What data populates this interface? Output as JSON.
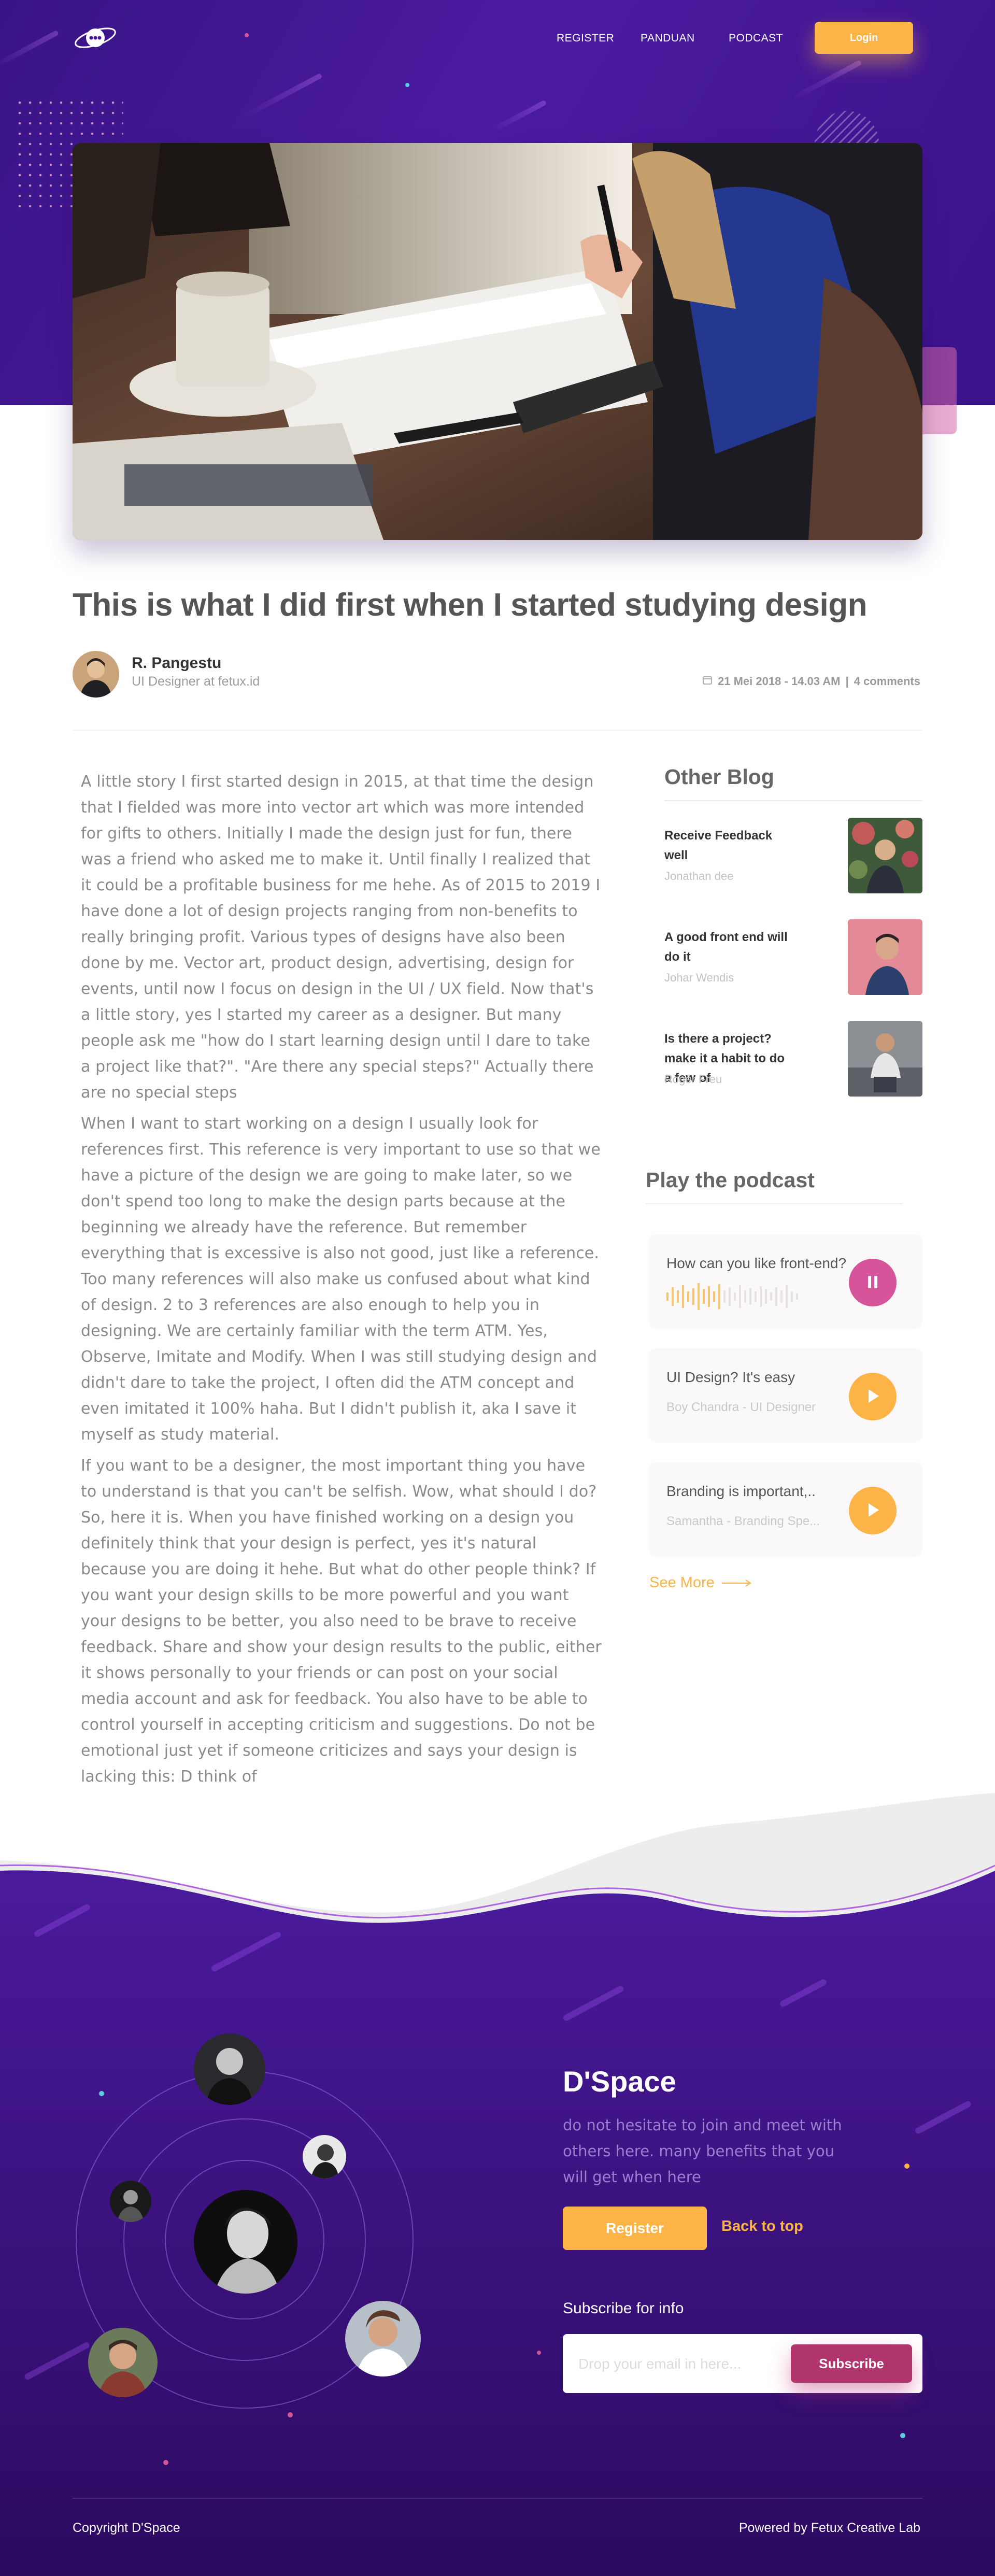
{
  "nav": {
    "logo_icon": "dspace-logo-icon",
    "links": [
      "REGISTER",
      "PANDUAN",
      "PODCAST"
    ],
    "login_label": "Login"
  },
  "hero": {
    "image": "people-studying-at-table-photo"
  },
  "article": {
    "title": "This is what I did first when I started studying design",
    "author_name": "R. Pangestu",
    "author_role": "UI Designer at fetux.id",
    "date": "21 Mei 2018 - 14.03 AM",
    "comments": "4 comments",
    "paragraphs": [
      "A little story I first started design in 2015, at that time the design that I fielded was more into vector art which was more intended for gifts to others. Initially I made the design just for fun, there was a friend who asked me to make it. Until finally I realized that it could be a profitable business for me hehe. As of 2015 to 2019 I have done a lot of design projects ranging from non-benefits to really bringing profit. Various types of designs have also been done by me. Vector art, product design, advertising, design for events, until now I focus on design in the UI / UX field. Now that's a little story, yes I started my career as a designer. But many people ask me \"how do I start learning design until I dare to take a project like that?\". \"Are there any special steps?\" Actually there are no special steps",
      "When I want to start working on a design I usually look for references first. This reference is very important to use so that we have a picture of the design we are going to make later, so we don't spend too long to make the design parts because at the beginning we already have the reference. But remember everything that is excessive is also not good, just like a reference. Too many references will also make us confused about what kind of design. 2 to 3 references are also enough to help you in designing. We are certainly familiar with the term ATM. Yes, Observe, Imitate and Modify. When I was still studying design and didn't dare to take the project, I often did the ATM concept and even imitated it 100% haha. But I didn't publish it, aka I save it myself as study material.",
      "If you want to be a designer, the most important thing you have to understand is that you can't be selfish. Wow, what should I do? So, here it is. When you have finished working on a design you definitely think that your design is perfect, yes it's natural because you are doing it hehe. But what do other people think? If you want your design skills to be more powerful and you want your designs to be better, you also need to be brave to receive feedback. Share and show your design results to the public, either it shows personally to your friends or can post on your social media account and ask for feedback. You also have to be able to control yourself in accepting criticism and suggestions. Do not be emotional just yet if someone criticizes and says your design is lacking this: D think of"
    ]
  },
  "sidebar": {
    "other_blog_title": "Other Blog",
    "blogs": [
      {
        "title": "Receive Feedback well",
        "author": "Jonathan dee",
        "thumb": "man-with-flowers-photo"
      },
      {
        "title": "A good front end will do it",
        "author": "Johar Wendis",
        "thumb": "man-pink-background-photo"
      },
      {
        "title": "Is there a project? make it a habit to do a few of",
        "author": "Roger Freu",
        "thumb": "man-crouching-photo"
      }
    ],
    "podcast_title": "Play the podcast",
    "podcasts": [
      {
        "title": "How can you like front-end?",
        "subtitle": "",
        "state": "playing",
        "icon": "pause-icon"
      },
      {
        "title": "UI Design? It's easy",
        "subtitle": "Boy Chandra - UI Designer",
        "state": "paused",
        "icon": "play-icon"
      },
      {
        "title": "Branding is important,..",
        "subtitle": "Samantha - Branding Spe...",
        "state": "paused",
        "icon": "play-icon"
      }
    ],
    "see_more": "See More"
  },
  "footer": {
    "brand": "D'Space",
    "description": "do not hesitate to join and meet with others here. many benefits that you will get when here",
    "register_label": "Register",
    "back_to_top": "Back to top",
    "subscribe_label": "Subscribe for info",
    "email_placeholder": "Drop your email in here...",
    "subscribe_button": "Subscribe",
    "copyright": "Copyright D'Space",
    "powered_by": "Powered by Fetux Creative Lab"
  },
  "colors": {
    "purple": "#4b1aa0",
    "accent_yellow": "#fdb446",
    "accent_pink": "#d6559a",
    "subscribe_magenta": "#b0356d"
  }
}
